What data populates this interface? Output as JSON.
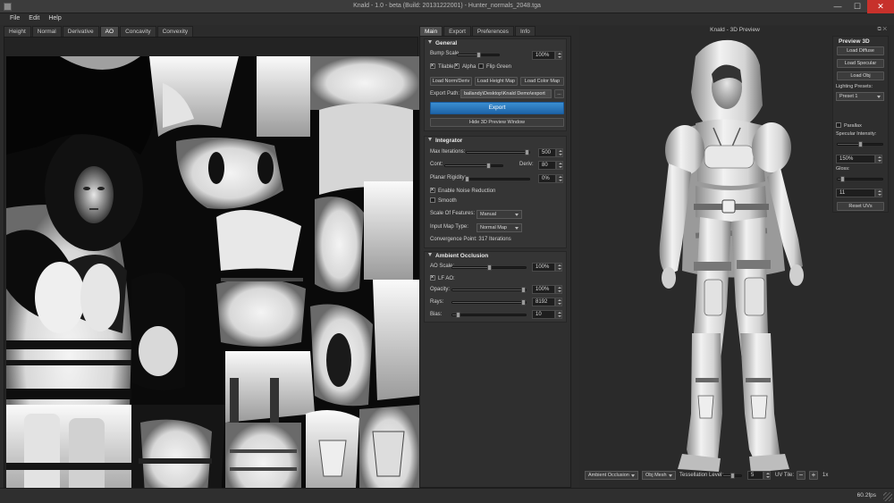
{
  "window": {
    "title": "Knald - 1.0 - beta (Build: 20131222001) - Hunter_normals_2048.tga",
    "minimize_glyph": "—",
    "maximize_glyph": "☐",
    "close_glyph": "✕"
  },
  "menu": [
    "File",
    "Edit",
    "Help"
  ],
  "map_tabs": [
    "Height",
    "Normal",
    "Derivative",
    "AO",
    "Concavity",
    "Convexity"
  ],
  "map_tabs_active": "AO",
  "panel_tabs": [
    "Main",
    "Export",
    "Preferences",
    "Info"
  ],
  "panel_tabs_active": "Main",
  "general": {
    "header": "General",
    "bump_scale_label": "Bump Scale",
    "bump_scale_value": "100%",
    "bump_scale_level": 0.5,
    "tileable_label": "Tilable",
    "tileable_checked": true,
    "alpha_label": "Alpha",
    "alpha_checked": true,
    "flip_green_label": "Flip Green",
    "flip_green_checked": false,
    "load_norm_label": "Load Norm/Deriv",
    "load_height_label": "Load Height Map",
    "load_color_label": "Load Color Map",
    "export_path_label": "Export Path:",
    "export_path_value": "ballandy\\Desktop\\Knald Demo\\export",
    "browse_label": "...",
    "export_button": "Export",
    "hide_preview_button": "Hide 3D Preview Window"
  },
  "integrator": {
    "header": "Integrator",
    "max_iterations_label": "Max Iterations:",
    "max_iterations_value": "500",
    "max_iterations_level": 0.97,
    "cont_label": "Cont:",
    "cont_level": 0.75,
    "deriv_label": "Deriv:",
    "deriv_value": "80",
    "planar_label": "Planar Rigidity:",
    "planar_value": "0%",
    "planar_level": 0.0,
    "noise_reduction_label": "Enable Noise Reduction",
    "noise_reduction_checked": true,
    "smooth_label": "Smooth",
    "smooth_checked": false,
    "scale_features_label": "Scale Of Features:",
    "scale_features_value": "Manual",
    "input_map_label": "Input Map Type:",
    "input_map_value": "Normal Map",
    "convergence_text": "Convergence Point: 317 Iterations"
  },
  "ambient_occlusion": {
    "header": "Ambient Occlusion",
    "ao_scale_label": "AO Scale:",
    "ao_scale_value": "100%",
    "ao_scale_level": 0.5,
    "lf_ao_label": "LF AO:",
    "lf_ao_checked": true,
    "opacity_label": "Opacity:",
    "opacity_value": "100%",
    "opacity_level": 1.0,
    "rays_label": "Rays:",
    "rays_value": "8192",
    "rays_level": 1.0,
    "bias_label": "Bias:",
    "bias_value": "10",
    "bias_level": 0.08
  },
  "view3d": {
    "title": "Knald - 3D Preview",
    "dock_icons": "⧉ ✕"
  },
  "preview3d": {
    "header": "Preview 3D",
    "load_diffuse": "Load Diffuse",
    "load_specular": "Load Specular",
    "load_obj": "Load Obj",
    "lighting_presets_label": "Lighting Presets:",
    "lighting_preset_value": "Preset 1",
    "parallax_label": "Parallax",
    "parallax_checked": false,
    "specular_intensity_label": "Specular Intensity:",
    "specular_intensity_level": 0.5,
    "specular_intensity_value": "150%",
    "gloss_label": "Gloss:",
    "gloss_level": 0.1,
    "gloss_value": "11",
    "reset_uvs": "Reset UVs"
  },
  "bottom_bar": {
    "display_mode": "Ambient Occlusion",
    "mesh": "Obj Mesh",
    "tessellation_label": "Tessellation Level:",
    "tessellation_value": "5",
    "tessellation_level": 0.5,
    "uv_tile_label": "UV Tile:",
    "uv_tile_minus": "−",
    "uv_tile_plus": "+",
    "uv_tile_value": "1x"
  },
  "status": {
    "fps": "60.2fps"
  }
}
